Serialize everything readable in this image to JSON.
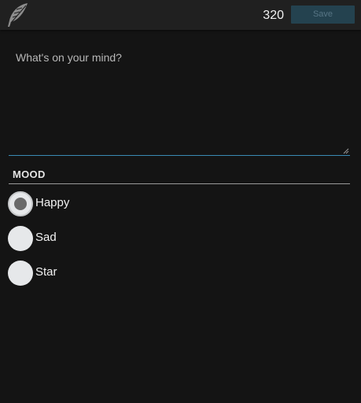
{
  "header": {
    "logo_icon": "feather-icon",
    "char_count": "320",
    "save_label": "Save"
  },
  "compose": {
    "placeholder": "What's on your mind?",
    "value": ""
  },
  "mood": {
    "title": "MOOD",
    "options": [
      {
        "label": "Happy",
        "checked": true
      },
      {
        "label": "Sad",
        "checked": false
      },
      {
        "label": "Star",
        "checked": false
      }
    ]
  },
  "colors": {
    "background": "#141414",
    "topbar": "#202020",
    "save_button_bg": "#24424f",
    "save_button_text": "#577585",
    "focus_underline": "#3a8ab5"
  }
}
